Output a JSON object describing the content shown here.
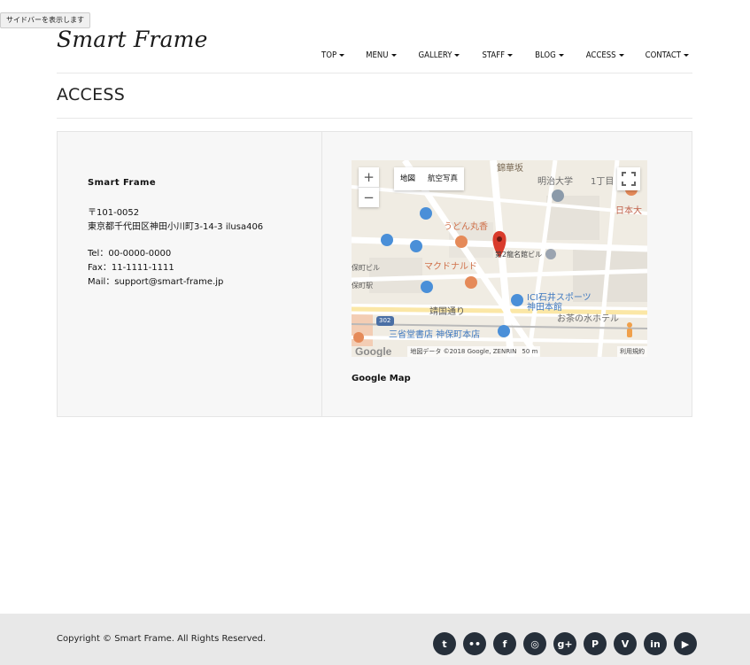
{
  "sidebar_toggle": "サイドバーを表示します",
  "site": {
    "logo": "Smart Frame"
  },
  "nav": {
    "items": [
      {
        "label": "TOP"
      },
      {
        "label": "MENU"
      },
      {
        "label": "GALLERY"
      },
      {
        "label": "STAFF"
      },
      {
        "label": "BLOG"
      },
      {
        "label": "ACCESS"
      },
      {
        "label": "CONTACT"
      }
    ]
  },
  "page": {
    "title": "ACCESS"
  },
  "info": {
    "company": "Smart Frame",
    "postal": "〒101-0052",
    "address": "東京都千代田区神田小川町3-14-3 ilusa406",
    "tel": "Tel：00-0000-0000",
    "fax": "Fax：11-1111-1111",
    "mail": "Mail：support@smart-frame.jp"
  },
  "map": {
    "zoom_in": "+",
    "zoom_out": "−",
    "type_map": "地図",
    "type_satellite": "航空写真",
    "labels": [
      "錦華坂",
      "明治大学",
      "1丁目",
      "日本大",
      "うどん丸香",
      "ICI石井スポーツ",
      "神田本館",
      "お茶の水ホテル",
      "マクドナルド",
      "靖国通り",
      "三省堂書店 神保町本店",
      "保町駅",
      "保町ビル",
      "第2龍名館ビル",
      "302"
    ],
    "google": "Google",
    "attribution": "地図データ ©2018 Google, ZENRIN",
    "scale": "50 m",
    "terms": "利用規約",
    "caption": "Google Map"
  },
  "footer": {
    "copyright": "Copyright © Smart Frame. All Rights Reserved.",
    "social": [
      {
        "name": "twitter",
        "glyph": "t"
      },
      {
        "name": "flickr",
        "glyph": "••"
      },
      {
        "name": "facebook",
        "glyph": "f"
      },
      {
        "name": "instagram",
        "glyph": "◎"
      },
      {
        "name": "google-plus",
        "glyph": "g+"
      },
      {
        "name": "pinterest",
        "glyph": "P"
      },
      {
        "name": "vimeo",
        "glyph": "V"
      },
      {
        "name": "linkedin",
        "glyph": "in"
      },
      {
        "name": "youtube",
        "glyph": "▶"
      }
    ]
  },
  "colors": {
    "footer_bg": "#e8e8e8",
    "panel_bg": "#f7f7f7",
    "icon_bg": "#262f3a",
    "map_pin": "#d93b2b"
  }
}
